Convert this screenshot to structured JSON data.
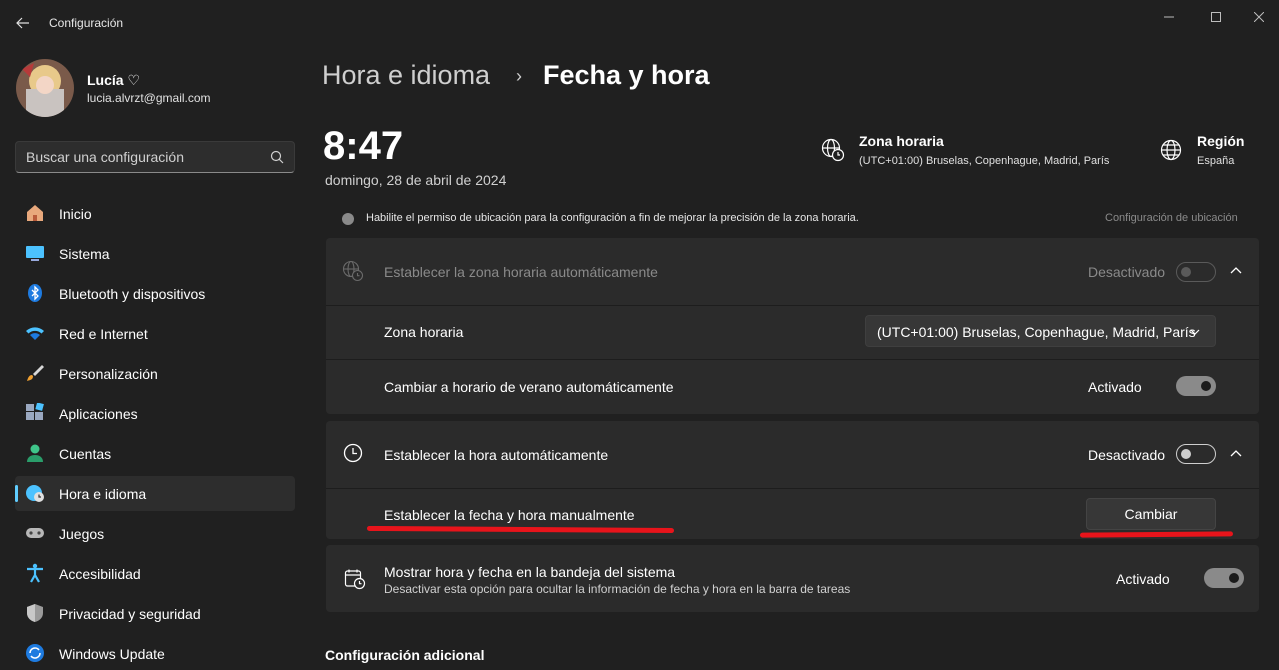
{
  "window": {
    "title": "Configuración",
    "back_icon": "arrow-left-icon",
    "minimize_icon": "minimize-icon",
    "maximize_icon": "maximize-icon",
    "close_icon": "close-icon"
  },
  "user": {
    "name": "Lucía ♡",
    "email": "lucia.alvrzt@gmail.com"
  },
  "search": {
    "placeholder": "Buscar una configuración",
    "icon": "search-icon"
  },
  "sidebar": {
    "accent_color": "#60cdff",
    "items": [
      {
        "label": "Inicio",
        "icon": "home-icon",
        "active": false
      },
      {
        "label": "Sistema",
        "icon": "monitor-icon",
        "active": false
      },
      {
        "label": "Bluetooth y dispositivos",
        "icon": "bluetooth-icon",
        "active": false
      },
      {
        "label": "Red e Internet",
        "icon": "wifi-icon",
        "active": false
      },
      {
        "label": "Personalización",
        "icon": "brush-icon",
        "active": false
      },
      {
        "label": "Aplicaciones",
        "icon": "apps-icon",
        "active": false
      },
      {
        "label": "Cuentas",
        "icon": "person-icon",
        "active": false
      },
      {
        "label": "Hora e idioma",
        "icon": "globe-clock-icon",
        "active": true
      },
      {
        "label": "Juegos",
        "icon": "gamepad-icon",
        "active": false
      },
      {
        "label": "Accesibilidad",
        "icon": "accessibility-icon",
        "active": false
      },
      {
        "label": "Privacidad y seguridad",
        "icon": "shield-icon",
        "active": false
      },
      {
        "label": "Windows Update",
        "icon": "update-icon",
        "active": false
      }
    ]
  },
  "breadcrumb": {
    "parent": "Hora e idioma",
    "separator": "›",
    "current": "Fecha y hora"
  },
  "clock": {
    "time": "8:47",
    "date": "domingo, 28 de abril de 2024"
  },
  "timezone_info": {
    "title": "Zona horaria",
    "value": "(UTC+01:00) Bruselas, Copenhague, Madrid, París",
    "icon": "globe-clock-icon"
  },
  "region_info": {
    "title": "Región",
    "value": "España",
    "icon": "globe-icon"
  },
  "notice": {
    "text": "Habilite el permiso de ubicación para la configuración a fin de mejorar la precisión de la zona horaria.",
    "link": "Configuración de ubicación",
    "icon": "info-icon"
  },
  "settings": {
    "auto_timezone": {
      "label": "Establecer la zona horaria automáticamente",
      "state": "Desactivado",
      "icon": "globe-clock-icon",
      "on": false,
      "disabled": true
    },
    "timezone": {
      "label": "Zona horaria",
      "value": "(UTC+01:00) Bruselas, Copenhague, Madrid, París"
    },
    "dst": {
      "label": "Cambiar a horario de verano automáticamente",
      "state": "Activado",
      "on": true
    },
    "auto_time": {
      "label": "Establecer la hora automáticamente",
      "state": "Desactivado",
      "icon": "clock-icon",
      "on": false
    },
    "manual": {
      "label": "Establecer la fecha y hora manualmente",
      "button": "Cambiar"
    },
    "tray": {
      "label": "Mostrar hora y fecha en la bandeja del sistema",
      "sublabel": "Desactivar esta opción para ocultar la información de fecha y hora en la barra de tareas",
      "state": "Activado",
      "icon": "calendar-clock-icon",
      "on": true
    }
  },
  "additional": {
    "title": "Configuración adicional"
  },
  "annotation_color": "#e8141b"
}
